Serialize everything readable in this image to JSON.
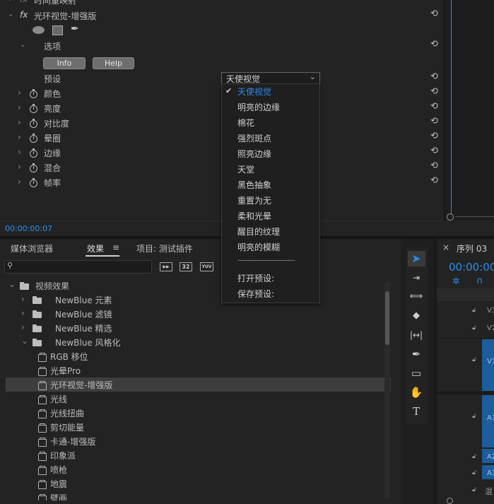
{
  "effect_controls": {
    "remap_label": "时间重映射",
    "effect_name": "光环视觉-增强版",
    "fx_badge": "fx",
    "options_label": "选项",
    "info_button": "Info",
    "help_button": "Help",
    "preset_label": "预设",
    "preset_value": "天使视觉",
    "params": [
      {
        "label": "颜色"
      },
      {
        "label": "亮度"
      },
      {
        "label": "对比度"
      },
      {
        "label": "晕圈"
      },
      {
        "label": "边缘"
      },
      {
        "label": "混合"
      },
      {
        "label": "帧率"
      }
    ],
    "timecode": "00:00:00:07"
  },
  "preset_dropdown": {
    "items": [
      "天使视觉",
      "明亮的边缘",
      "棉花",
      "强烈斑点",
      "照亮边缘",
      "天堂",
      "黑色抽象",
      "重置为无",
      "柔和光晕",
      "醒目的纹理",
      "明亮的模糊"
    ],
    "selected": "天使视觉",
    "separator": "——————————",
    "actions": [
      "打开预设:",
      "保存预设:"
    ]
  },
  "effects_panel": {
    "tabs": [
      {
        "label": "媒体浏览器"
      },
      {
        "label": "效果"
      },
      {
        "label": "项目: 测试插件"
      }
    ],
    "menu_icon": "≡",
    "search_placeholder": "",
    "filter_badges": [
      "▶▶",
      "32",
      "YUV"
    ],
    "tree": [
      {
        "label": "视频效果",
        "type": "folder",
        "level": 0,
        "expanded": true
      },
      {
        "label": "NewBlue 元素",
        "type": "folder",
        "level": 1,
        "expanded": false
      },
      {
        "label": "NewBlue 滤镜",
        "type": "folder",
        "level": 1,
        "expanded": false
      },
      {
        "label": "NewBlue 精选",
        "type": "folder",
        "level": 1,
        "expanded": false
      },
      {
        "label": "NewBlue 风格化",
        "type": "folder",
        "level": 1,
        "expanded": true
      },
      {
        "label": "RGB 移位",
        "type": "effect",
        "level": 2
      },
      {
        "label": "光晕Pro",
        "type": "effect",
        "level": 2
      },
      {
        "label": "光环视觉-增强版",
        "type": "effect",
        "level": 2,
        "selected": true
      },
      {
        "label": "光线",
        "type": "effect",
        "level": 2
      },
      {
        "label": "光线扭曲",
        "type": "effect",
        "level": 2
      },
      {
        "label": "剪切能量",
        "type": "effect",
        "level": 2
      },
      {
        "label": "卡通-增强版",
        "type": "effect",
        "level": 2
      },
      {
        "label": "印象派",
        "type": "effect",
        "level": 2
      },
      {
        "label": "喷枪",
        "type": "effect",
        "level": 2
      },
      {
        "label": "地震",
        "type": "effect",
        "level": 2
      },
      {
        "label": "壁画",
        "type": "effect",
        "level": 2
      }
    ]
  },
  "timeline": {
    "close_icon": "×",
    "sequence_name": "序列 03",
    "timecode": "00:00:00",
    "tracks": [
      "V3",
      "V2",
      "V1",
      "A1",
      "A2",
      "A3",
      "混"
    ]
  },
  "colors": {
    "accent": "#2d8ceb",
    "clip_blue": "#1c5d9c",
    "panel_bg": "#232323"
  }
}
